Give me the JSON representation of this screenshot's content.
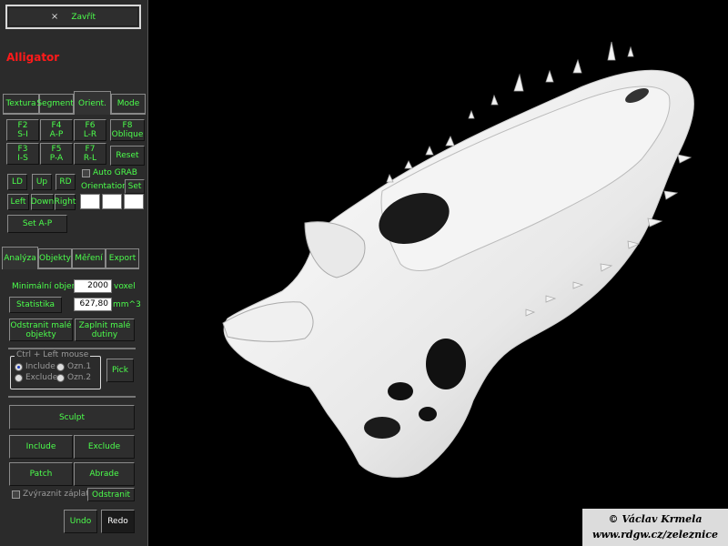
{
  "panel": {
    "close_icon": "×",
    "close_label": "Zavřít",
    "title": "Alligator",
    "top_tabs": [
      "Textura",
      "Segment.",
      "Orient.",
      "Mode"
    ],
    "fkeys": [
      {
        "key": "F2",
        "label": "S-I"
      },
      {
        "key": "F4",
        "label": "A-P"
      },
      {
        "key": "F6",
        "label": "L-R"
      },
      {
        "key": "F8",
        "label": "Oblique"
      },
      {
        "key": "F3",
        "label": "I-S"
      },
      {
        "key": "F5",
        "label": "P-A"
      },
      {
        "key": "F7",
        "label": "R-L"
      }
    ],
    "reset_label": "Reset",
    "nav": {
      "ld": "LD",
      "up": "Up",
      "rd": "RD",
      "left": "Left",
      "down": "Down",
      "right": "Right"
    },
    "auto_grab_label": "Auto GRAB",
    "orientation_label": "Orientation:",
    "set_label": "Set",
    "set_ap_label": "Set A-P",
    "bottom_tabs": [
      "Analýza",
      "Objekty",
      "Měření",
      "Export"
    ],
    "min_volume_label": "Minimální objem",
    "min_volume_value": "2000",
    "voxel_unit": "voxel",
    "stats_label": "Statistika",
    "stats_value": "627,80",
    "stats_unit": "mm^3",
    "remove_small_line1": "Odstranit malé",
    "remove_small_line2": "objekty",
    "fill_small_line1": "Zaplnit malé",
    "fill_small_line2": "dutiny",
    "group_label": "Ctrl + Left mouse",
    "radio_include": "Include",
    "radio_exclude": "Exclude",
    "radio_ozn1": "Ozn.1",
    "radio_ozn2": "Ozn.2",
    "pick_label": "Pick",
    "sculpt_label": "Sculpt",
    "include_label": "Include",
    "exclude_label": "Exclude",
    "patch_label": "Patch",
    "abrade_label": "Abrade",
    "highlight_patches_label": "Zvýraznit záplaty",
    "remove_label": "Odstranit",
    "undo_label": "Undo",
    "redo_label": "Redo"
  },
  "watermark": {
    "line1": "© Václav Krmela",
    "line2": "www.rdgw.cz/zeleznice"
  },
  "colors": {
    "panel_bg": "#2b2b2b",
    "button_text": "#4cff4c",
    "title": "#ff1a1a",
    "viewport_bg": "#000000",
    "model": "#efefef"
  }
}
